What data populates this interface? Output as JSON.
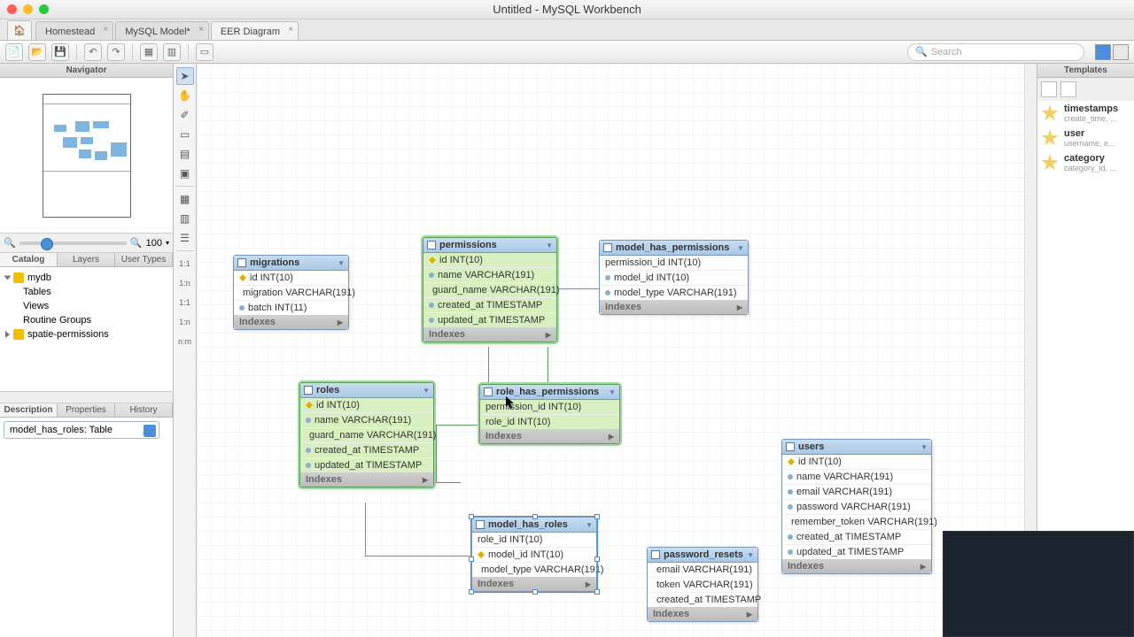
{
  "window": {
    "title": "Untitled - MySQL Workbench"
  },
  "tabs": [
    {
      "label": "Homestead",
      "active": false
    },
    {
      "label": "MySQL Model*",
      "active": false
    },
    {
      "label": "EER Diagram",
      "active": true
    }
  ],
  "search": {
    "placeholder": "Search"
  },
  "navigator": {
    "header": "Navigator",
    "zoom": "100",
    "subtabs": [
      "Catalog",
      "Layers",
      "User Types"
    ],
    "tree": {
      "db1": "mydb",
      "db1_items": [
        "Tables",
        "Views",
        "Routine Groups"
      ],
      "db2": "spatie-permissions"
    },
    "desc_tabs": [
      "Description",
      "Properties",
      "History"
    ],
    "combo": "model_has_roles: Table"
  },
  "templates": {
    "header": "Templates",
    "items": [
      {
        "name": "timestamps",
        "sub": "create_time, ..."
      },
      {
        "name": "user",
        "sub": "username, e..."
      },
      {
        "name": "category",
        "sub": "category_id, ..."
      }
    ]
  },
  "tool_labels": {
    "r11": "1:1",
    "r1n": "1:n",
    "rnn": "n:m",
    "r11b": "1:1",
    "r1nb": "1:n"
  },
  "tables": {
    "migrations": {
      "name": "migrations",
      "cols": [
        "id INT(10)",
        "migration VARCHAR(191)",
        "batch INT(11)"
      ],
      "idx": "Indexes"
    },
    "permissions": {
      "name": "permissions",
      "cols": [
        "id INT(10)",
        "name VARCHAR(191)",
        "guard_name VARCHAR(191)",
        "created_at TIMESTAMP",
        "updated_at TIMESTAMP"
      ],
      "idx": "Indexes"
    },
    "model_has_permissions": {
      "name": "model_has_permissions",
      "cols": [
        "permission_id INT(10)",
        "model_id INT(10)",
        "model_type VARCHAR(191)"
      ],
      "idx": "Indexes"
    },
    "roles": {
      "name": "roles",
      "cols": [
        "id INT(10)",
        "name VARCHAR(191)",
        "guard_name VARCHAR(191)",
        "created_at TIMESTAMP",
        "updated_at TIMESTAMP"
      ],
      "idx": "Indexes"
    },
    "role_has_permissions": {
      "name": "role_has_permissions",
      "cols": [
        "permission_id INT(10)",
        "role_id INT(10)"
      ],
      "idx": "Indexes"
    },
    "model_has_roles": {
      "name": "model_has_roles",
      "cols": [
        "role_id INT(10)",
        "model_id INT(10)",
        "model_type VARCHAR(191)"
      ],
      "idx": "Indexes"
    },
    "users": {
      "name": "users",
      "cols": [
        "id INT(10)",
        "name VARCHAR(191)",
        "email VARCHAR(191)",
        "password VARCHAR(191)",
        "remember_token VARCHAR(191)",
        "created_at TIMESTAMP",
        "updated_at TIMESTAMP"
      ],
      "idx": "Indexes"
    },
    "password_resets": {
      "name": "password_resets",
      "cols": [
        "email VARCHAR(191)",
        "token VARCHAR(191)",
        "created_at TIMESTAMP"
      ],
      "idx": "Indexes"
    }
  }
}
